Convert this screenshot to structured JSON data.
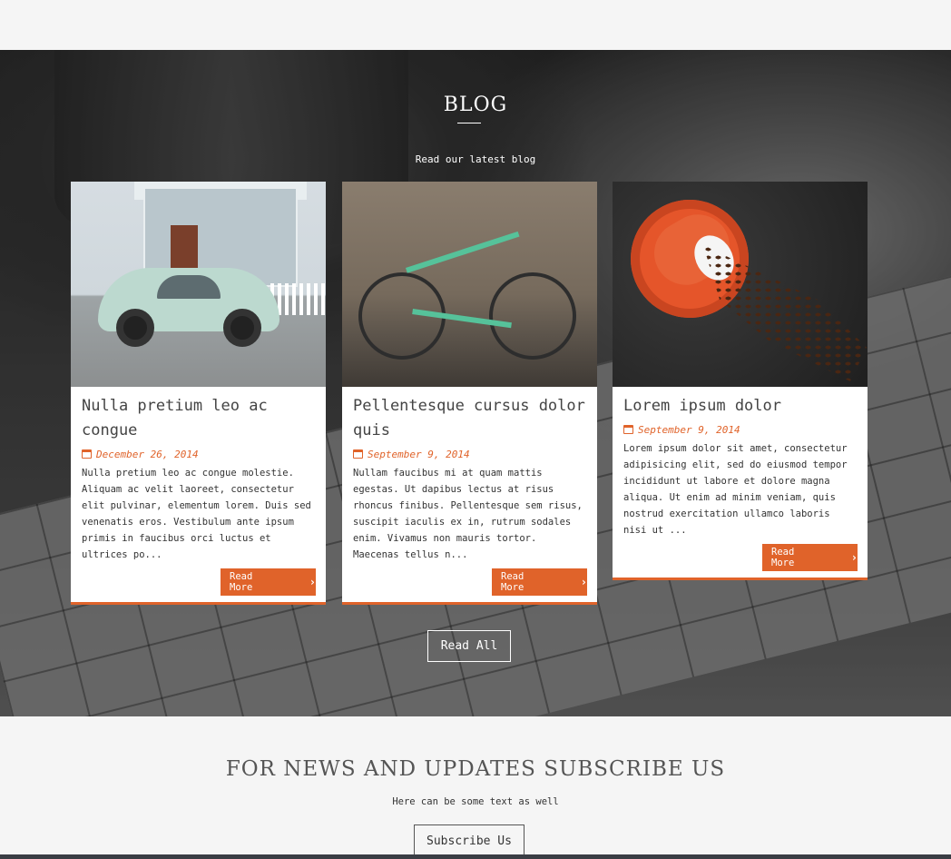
{
  "blog": {
    "title": "BLOG",
    "subtitle": "Read our latest blog",
    "read_all_label": "Read All",
    "posts": [
      {
        "title": "Nulla pretium leo ac congue",
        "date": "December 26, 2014",
        "excerpt": "Nulla pretium leo ac congue molestie. Aliquam ac velit laoreet, consectetur elit pulvinar, elementum lorem. Duis sed venenatis eros. Vestibulum ante ipsum primis in faucibus orci luctus et ultrices po...",
        "read_more_label": "Read More",
        "image": "vintage-car-house-photo"
      },
      {
        "title": "Pellentesque cursus dolor quis",
        "date": "September 9, 2014",
        "excerpt": "Nullam faucibus mi at quam mattis egestas. Ut dapibus lectus at risus rhoncus finibus. Pellentesque sem risus, suscipit iaculis ex in, rutrum sodales enim. Vivamus non mauris tortor. Maecenas tellus n...",
        "read_more_label": "Read More",
        "image": "green-bicycle-photo"
      },
      {
        "title": "Lorem ipsum dolor",
        "date": "September 9, 2014",
        "excerpt": "Lorem ipsum dolor sit amet, consectetur adipisicing elit, sed do eiusmod tempor incididunt ut labore et dolore magna aliqua. Ut enim ad minim veniam, quis nostrud exercitation ullamco laboris nisi ut ...",
        "read_more_label": "Read More",
        "image": "coffee-cup-beans-photo"
      }
    ]
  },
  "subscribe": {
    "title": "FOR NEWS AND UPDATES SUBSCRIBE US",
    "text": "Here can be some text as well",
    "button_label": "Subscribe Us"
  },
  "colors": {
    "accent": "#e0632a",
    "page_bg": "#f5f5f5",
    "card_bg": "#ffffff"
  },
  "icons": {
    "date": "calendar-icon",
    "read_more": "chevron-right-icon"
  }
}
